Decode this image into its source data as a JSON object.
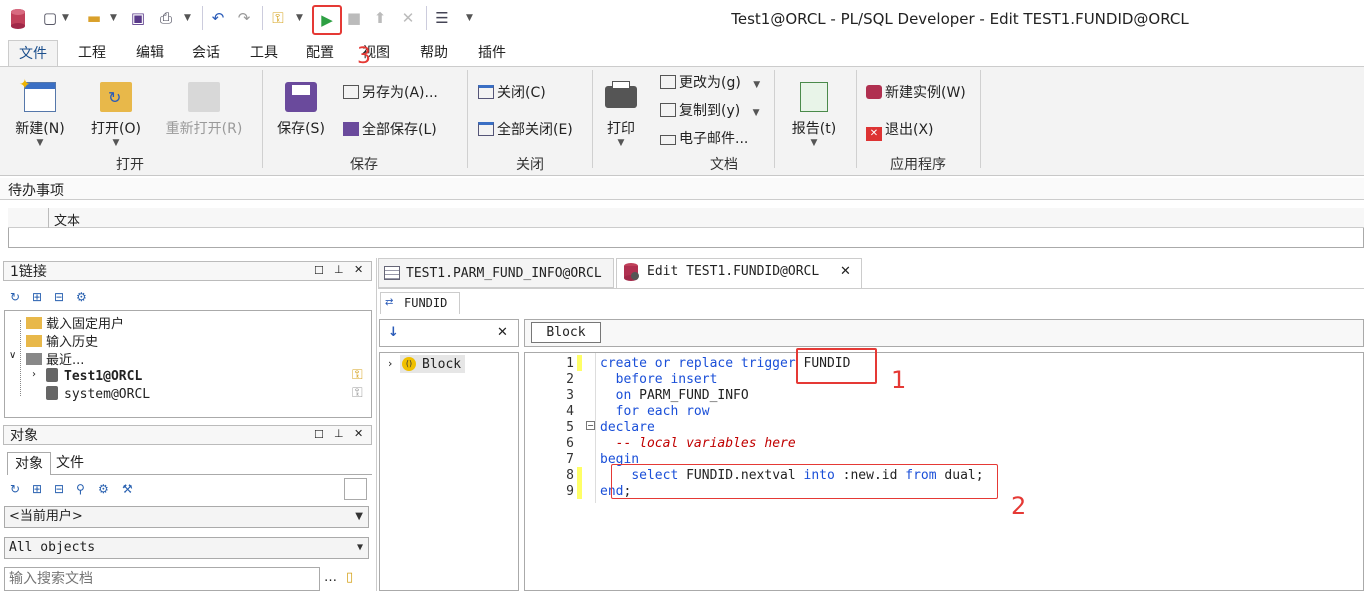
{
  "window": {
    "title": "Test1@ORCL - PL/SQL Developer - Edit TEST1.FUNDID@ORCL"
  },
  "menu": [
    "文件",
    "工程",
    "编辑",
    "会话",
    "工具",
    "配置",
    "视图",
    "帮助",
    "插件"
  ],
  "ribbon": {
    "open_group": {
      "new": "新建(N)",
      "open": "打开(O)",
      "reopen": "重新打开(R)",
      "label": "打开"
    },
    "save_group": {
      "save": "保存(S)",
      "save_as": "另存为(A)...",
      "save_all": "全部保存(L)",
      "label": "保存"
    },
    "close_group": {
      "close": "关闭(C)",
      "close_all": "全部关闭(E)",
      "label": "关闭"
    },
    "doc_group": {
      "print": "打印",
      "change_to": "更改为(g)",
      "copy_to": "复制到(y)",
      "email": "电子邮件...",
      "label": "文档"
    },
    "report_group": {
      "report": "报告(t)"
    },
    "app_group": {
      "new_instance": "新建实例(W)",
      "exit": "退出(X)",
      "label": "应用程序"
    }
  },
  "todo": {
    "title": "待办事项",
    "col_text": "文本"
  },
  "connections": {
    "title": "1链接",
    "items": [
      {
        "label": "载入固定用户"
      },
      {
        "label": "输入历史"
      },
      {
        "label": "最近..."
      },
      {
        "label": "Test1@ORCL"
      },
      {
        "label": "system@ORCL"
      }
    ]
  },
  "objects": {
    "title": "对象",
    "tab_objects": "对象",
    "tab_files": "文件",
    "user_combo": "<当前用户>",
    "filter_combo": "All objects",
    "search_placeholder": "输入搜索文档"
  },
  "tabs": [
    {
      "label": "TEST1.PARM_FUND_INFO@ORCL"
    },
    {
      "label": "Edit TEST1.FUNDID@ORCL"
    }
  ],
  "editor": {
    "object_tab": "FUNDID",
    "block_label": "Block",
    "tree_block": "Block",
    "lines": [
      {
        "n": "1"
      },
      {
        "n": "2"
      },
      {
        "n": "3"
      },
      {
        "n": "4"
      },
      {
        "n": "5"
      },
      {
        "n": "6"
      },
      {
        "n": "7"
      },
      {
        "n": "8"
      },
      {
        "n": "9"
      }
    ],
    "code": {
      "l1_kw": "create or replace trigger",
      "l1_name": "FUNDID",
      "l2": "before insert",
      "l3_kw": "on",
      "l3_name": "PARM_FUND_INFO",
      "l4": "for each row",
      "l5": "declare",
      "l6": "-- local variables here",
      "l7": "begin",
      "l8_a": "select",
      "l8_b": "FUNDID.nextval",
      "l8_c": "into",
      ":": "",
      "l8_d": ":new.id",
      "l8_e": "from",
      "l8_f": "dual;",
      "l9_kw": "end",
      "l9_p": ";"
    }
  },
  "annotations": {
    "a1": "1",
    "a2": "2",
    "a3": "3"
  },
  "colors": {
    "accent": "#1a4e8c",
    "annotation": "#e53935",
    "run": "#2ea043"
  }
}
